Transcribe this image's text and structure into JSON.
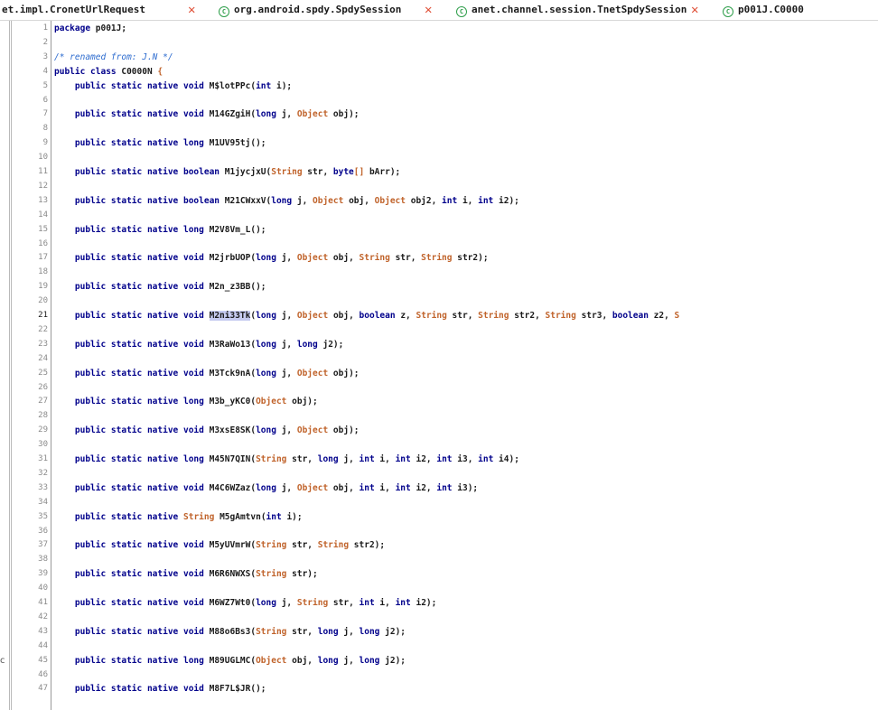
{
  "tabs": [
    {
      "label": "et.impl.CronetUrlRequest",
      "has_icon": false
    },
    {
      "label": "org.android.spdy.SpdySession",
      "has_icon": true
    },
    {
      "label": "anet.channel.session.TnetSpdySession",
      "has_icon": true
    },
    {
      "label": "p001J.C0000",
      "has_icon": true
    }
  ],
  "tab_icon_glyph": "C",
  "tab_close_glyph": "✕",
  "side_mark": "c",
  "highlighted_identifier": "M2ni33Tk",
  "current_line": 21,
  "colors": {
    "keyword": "#00008b",
    "type": "#c0632b",
    "comment": "#2c6bcf",
    "highlight": "#c6cbf0"
  },
  "lines": [
    {
      "n": "1",
      "t": [
        [
          "kw",
          "package"
        ],
        [
          "pn",
          " p001J;"
        ]
      ]
    },
    {
      "n": "2",
      "t": []
    },
    {
      "n": "3",
      "t": [
        [
          "cm",
          "/* renamed from: J.N */"
        ]
      ]
    },
    {
      "n": "4",
      "t": [
        [
          "kw",
          "public class"
        ],
        [
          "pn",
          " C0000N "
        ],
        [
          "ty",
          "{"
        ]
      ]
    },
    {
      "n": "5",
      "t": [
        [
          "kw",
          "    public static native void"
        ],
        [
          "pn",
          " M$lotPPc("
        ],
        [
          "kw",
          "int"
        ],
        [
          "pn",
          " i);"
        ]
      ]
    },
    {
      "n": "6",
      "t": []
    },
    {
      "n": "7",
      "t": [
        [
          "kw",
          "    public static native void"
        ],
        [
          "pn",
          " M14GZgiH("
        ],
        [
          "kw",
          "long"
        ],
        [
          "pn",
          " j, "
        ],
        [
          "ty",
          "Object"
        ],
        [
          "pn",
          " obj);"
        ]
      ]
    },
    {
      "n": "8",
      "t": []
    },
    {
      "n": "9",
      "t": [
        [
          "kw",
          "    public static native long"
        ],
        [
          "pn",
          " M1UV95tj();"
        ]
      ]
    },
    {
      "n": "10",
      "t": []
    },
    {
      "n": "11",
      "t": [
        [
          "kw",
          "    public static native boolean"
        ],
        [
          "pn",
          " M1jycjxU("
        ],
        [
          "ty",
          "String"
        ],
        [
          "pn",
          " str, "
        ],
        [
          "kw",
          "byte"
        ],
        [
          "ty",
          "[]"
        ],
        [
          "pn",
          " bArr);"
        ]
      ]
    },
    {
      "n": "12",
      "t": []
    },
    {
      "n": "13",
      "t": [
        [
          "kw",
          "    public static native boolean"
        ],
        [
          "pn",
          " M21CWxxV("
        ],
        [
          "kw",
          "long"
        ],
        [
          "pn",
          " j, "
        ],
        [
          "ty",
          "Object"
        ],
        [
          "pn",
          " obj, "
        ],
        [
          "ty",
          "Object"
        ],
        [
          "pn",
          " obj2, "
        ],
        [
          "kw",
          "int"
        ],
        [
          "pn",
          " i, "
        ],
        [
          "kw",
          "int"
        ],
        [
          "pn",
          " i2);"
        ]
      ]
    },
    {
      "n": "14",
      "t": []
    },
    {
      "n": "15",
      "t": [
        [
          "kw",
          "    public static native long"
        ],
        [
          "pn",
          " M2V8Vm_L();"
        ]
      ]
    },
    {
      "n": "16",
      "t": []
    },
    {
      "n": "17",
      "t": [
        [
          "kw",
          "    public static native void"
        ],
        [
          "pn",
          " M2jrbUOP("
        ],
        [
          "kw",
          "long"
        ],
        [
          "pn",
          " j, "
        ],
        [
          "ty",
          "Object"
        ],
        [
          "pn",
          " obj, "
        ],
        [
          "ty",
          "String"
        ],
        [
          "pn",
          " str, "
        ],
        [
          "ty",
          "String"
        ],
        [
          "pn",
          " str2);"
        ]
      ]
    },
    {
      "n": "18",
      "t": []
    },
    {
      "n": "19",
      "t": [
        [
          "kw",
          "    public static native void"
        ],
        [
          "pn",
          " M2n_z3BB();"
        ]
      ]
    },
    {
      "n": "20",
      "t": []
    },
    {
      "n": "21",
      "t": [
        [
          "kw",
          "    public static native void"
        ],
        [
          "pn",
          " "
        ],
        [
          "hl",
          "M2ni33Tk"
        ],
        [
          "pn",
          "("
        ],
        [
          "kw",
          "long"
        ],
        [
          "pn",
          " j, "
        ],
        [
          "ty",
          "Object"
        ],
        [
          "pn",
          " obj, "
        ],
        [
          "kw",
          "boolean"
        ],
        [
          "pn",
          " z, "
        ],
        [
          "ty",
          "String"
        ],
        [
          "pn",
          " str, "
        ],
        [
          "ty",
          "String"
        ],
        [
          "pn",
          " str2, "
        ],
        [
          "ty",
          "String"
        ],
        [
          "pn",
          " str3, "
        ],
        [
          "kw",
          "boolean"
        ],
        [
          "pn",
          " z2, "
        ],
        [
          "ty",
          "S"
        ]
      ]
    },
    {
      "n": "22",
      "t": []
    },
    {
      "n": "23",
      "t": [
        [
          "kw",
          "    public static native void"
        ],
        [
          "pn",
          " M3RaWo13("
        ],
        [
          "kw",
          "long"
        ],
        [
          "pn",
          " j, "
        ],
        [
          "kw",
          "long"
        ],
        [
          "pn",
          " j2);"
        ]
      ]
    },
    {
      "n": "24",
      "t": []
    },
    {
      "n": "25",
      "t": [
        [
          "kw",
          "    public static native void"
        ],
        [
          "pn",
          " M3Tck9nA("
        ],
        [
          "kw",
          "long"
        ],
        [
          "pn",
          " j, "
        ],
        [
          "ty",
          "Object"
        ],
        [
          "pn",
          " obj);"
        ]
      ]
    },
    {
      "n": "26",
      "t": []
    },
    {
      "n": "27",
      "t": [
        [
          "kw",
          "    public static native long"
        ],
        [
          "pn",
          " M3b_yKC0("
        ],
        [
          "ty",
          "Object"
        ],
        [
          "pn",
          " obj);"
        ]
      ]
    },
    {
      "n": "28",
      "t": []
    },
    {
      "n": "29",
      "t": [
        [
          "kw",
          "    public static native void"
        ],
        [
          "pn",
          " M3xsE8SK("
        ],
        [
          "kw",
          "long"
        ],
        [
          "pn",
          " j, "
        ],
        [
          "ty",
          "Object"
        ],
        [
          "pn",
          " obj);"
        ]
      ]
    },
    {
      "n": "30",
      "t": []
    },
    {
      "n": "31",
      "t": [
        [
          "kw",
          "    public static native long"
        ],
        [
          "pn",
          " M45N7QIN("
        ],
        [
          "ty",
          "String"
        ],
        [
          "pn",
          " str, "
        ],
        [
          "kw",
          "long"
        ],
        [
          "pn",
          " j, "
        ],
        [
          "kw",
          "int"
        ],
        [
          "pn",
          " i, "
        ],
        [
          "kw",
          "int"
        ],
        [
          "pn",
          " i2, "
        ],
        [
          "kw",
          "int"
        ],
        [
          "pn",
          " i3, "
        ],
        [
          "kw",
          "int"
        ],
        [
          "pn",
          " i4);"
        ]
      ]
    },
    {
      "n": "32",
      "t": []
    },
    {
      "n": "33",
      "t": [
        [
          "kw",
          "    public static native void"
        ],
        [
          "pn",
          " M4C6WZaz("
        ],
        [
          "kw",
          "long"
        ],
        [
          "pn",
          " j, "
        ],
        [
          "ty",
          "Object"
        ],
        [
          "pn",
          " obj, "
        ],
        [
          "kw",
          "int"
        ],
        [
          "pn",
          " i, "
        ],
        [
          "kw",
          "int"
        ],
        [
          "pn",
          " i2, "
        ],
        [
          "kw",
          "int"
        ],
        [
          "pn",
          " i3);"
        ]
      ]
    },
    {
      "n": "34",
      "t": []
    },
    {
      "n": "35",
      "t": [
        [
          "kw",
          "    public static native"
        ],
        [
          "pn",
          " "
        ],
        [
          "ty",
          "String"
        ],
        [
          "pn",
          " M5gAmtvn("
        ],
        [
          "kw",
          "int"
        ],
        [
          "pn",
          " i);"
        ]
      ]
    },
    {
      "n": "36",
      "t": []
    },
    {
      "n": "37",
      "t": [
        [
          "kw",
          "    public static native void"
        ],
        [
          "pn",
          " M5yUVmrW("
        ],
        [
          "ty",
          "String"
        ],
        [
          "pn",
          " str, "
        ],
        [
          "ty",
          "String"
        ],
        [
          "pn",
          " str2);"
        ]
      ]
    },
    {
      "n": "38",
      "t": []
    },
    {
      "n": "39",
      "t": [
        [
          "kw",
          "    public static native void"
        ],
        [
          "pn",
          " M6R6NWXS("
        ],
        [
          "ty",
          "String"
        ],
        [
          "pn",
          " str);"
        ]
      ]
    },
    {
      "n": "40",
      "t": []
    },
    {
      "n": "41",
      "t": [
        [
          "kw",
          "    public static native void"
        ],
        [
          "pn",
          " M6WZ7Wt0("
        ],
        [
          "kw",
          "long"
        ],
        [
          "pn",
          " j, "
        ],
        [
          "ty",
          "String"
        ],
        [
          "pn",
          " str, "
        ],
        [
          "kw",
          "int"
        ],
        [
          "pn",
          " i, "
        ],
        [
          "kw",
          "int"
        ],
        [
          "pn",
          " i2);"
        ]
      ]
    },
    {
      "n": "42",
      "t": []
    },
    {
      "n": "43",
      "t": [
        [
          "kw",
          "    public static native void"
        ],
        [
          "pn",
          " M88o6Bs3("
        ],
        [
          "ty",
          "String"
        ],
        [
          "pn",
          " str, "
        ],
        [
          "kw",
          "long"
        ],
        [
          "pn",
          " j, "
        ],
        [
          "kw",
          "long"
        ],
        [
          "pn",
          " j2);"
        ]
      ]
    },
    {
      "n": "44",
      "t": []
    },
    {
      "n": "45",
      "t": [
        [
          "kw",
          "    public static native long"
        ],
        [
          "pn",
          " M89UGLMC("
        ],
        [
          "ty",
          "Object"
        ],
        [
          "pn",
          " obj, "
        ],
        [
          "kw",
          "long"
        ],
        [
          "pn",
          " j, "
        ],
        [
          "kw",
          "long"
        ],
        [
          "pn",
          " j2);"
        ]
      ]
    },
    {
      "n": "46",
      "t": []
    },
    {
      "n": "47",
      "t": [
        [
          "kw",
          "    public static native void"
        ],
        [
          "pn",
          " M8F7L$JR();"
        ]
      ]
    }
  ]
}
